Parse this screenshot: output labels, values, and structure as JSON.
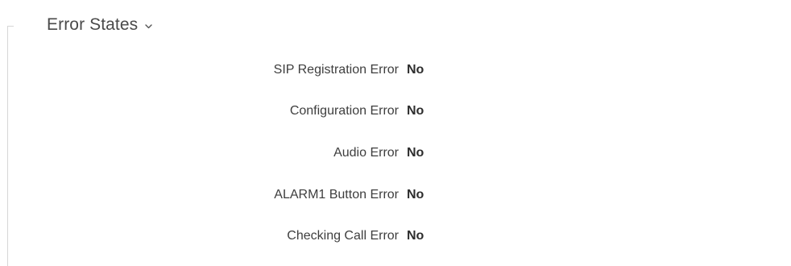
{
  "section": {
    "title": "Error States",
    "chevron_icon": "chevron-down-icon"
  },
  "rows": [
    {
      "label": "SIP Registration Error",
      "value": "No"
    },
    {
      "label": "Configuration Error",
      "value": "No"
    },
    {
      "label": "Audio Error",
      "value": "No"
    },
    {
      "label": "ALARM1 Button Error",
      "value": "No"
    },
    {
      "label": "Checking Call Error",
      "value": "No"
    }
  ]
}
